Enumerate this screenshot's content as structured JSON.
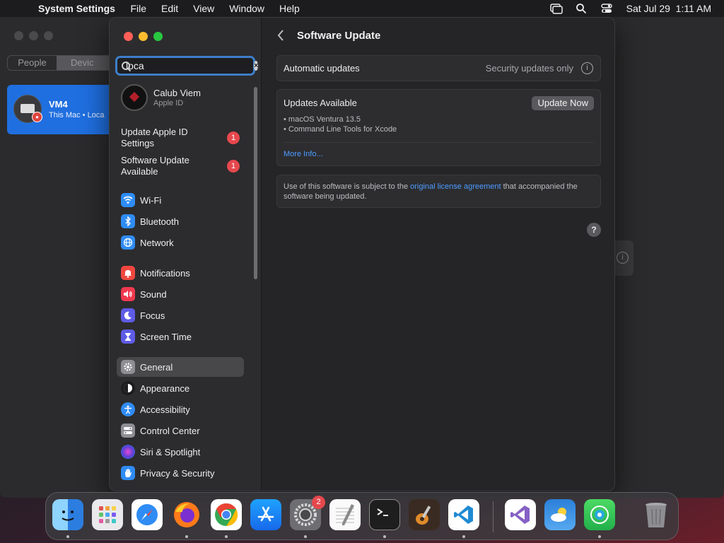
{
  "menubar": {
    "app_name": "System Settings",
    "menus": [
      "File",
      "Edit",
      "View",
      "Window",
      "Help"
    ],
    "datetime": "Sat Jul 29  1:11 AM"
  },
  "background_window": {
    "segments": [
      "People",
      "Devic"
    ],
    "device": {
      "name": "VM4",
      "subtitle": "This Mac • Loca"
    }
  },
  "sidebar": {
    "search": {
      "value": "loca",
      "placeholder": "Search"
    },
    "account": {
      "name": "Calub Viem",
      "subtitle": "Apple ID"
    },
    "alerts": [
      {
        "label": "Update Apple ID Settings",
        "badge": "1"
      },
      {
        "label": "Software Update Available",
        "badge": "1"
      }
    ],
    "items": [
      {
        "label": "Wi-Fi",
        "icon": "wifi-icon",
        "color": "#2f8cf4"
      },
      {
        "label": "Bluetooth",
        "icon": "bluetooth-icon",
        "color": "#2f8cf4"
      },
      {
        "label": "Network",
        "icon": "network-globe-icon",
        "color": "#2f8cf4"
      },
      {
        "label": "Notifications",
        "icon": "bell-icon",
        "color": "#f0473f"
      },
      {
        "label": "Sound",
        "icon": "speaker-icon",
        "color": "#f0394e"
      },
      {
        "label": "Focus",
        "icon": "moon-icon",
        "color": "#5e5ce6"
      },
      {
        "label": "Screen Time",
        "icon": "hourglass-icon",
        "color": "#5e5ce6"
      },
      {
        "label": "General",
        "icon": "gear-icon",
        "color": "#8e8e93"
      },
      {
        "label": "Appearance",
        "icon": "appearance-icon",
        "color": "#1c1c1e"
      },
      {
        "label": "Accessibility",
        "icon": "accessibility-icon",
        "color": "#2f8cf4"
      },
      {
        "label": "Control Center",
        "icon": "control-center-icon",
        "color": "#8e8e93"
      },
      {
        "label": "Siri & Spotlight",
        "icon": "siri-icon",
        "color": "#7a4fd8"
      },
      {
        "label": "Privacy & Security",
        "icon": "hand-icon",
        "color": "#2f8cf4"
      }
    ],
    "selected": "General"
  },
  "content": {
    "title": "Software Update",
    "automatic": {
      "label": "Automatic updates",
      "value": "Security updates only"
    },
    "updates": {
      "title": "Updates Available",
      "button": "Update Now",
      "items": [
        "• macOS Ventura 13.5",
        "• Command Line Tools for Xcode"
      ],
      "more_info": "More Info..."
    },
    "license": {
      "before": "Use of this software is subject to the ",
      "link": "original license agreement",
      "after": " that accompanied the software being updated."
    },
    "help": "?"
  },
  "dock": {
    "apps": [
      {
        "name": "Finder",
        "icon": "finder-icon"
      },
      {
        "name": "Launchpad",
        "icon": "launchpad-icon"
      },
      {
        "name": "Safari",
        "icon": "safari-icon"
      },
      {
        "name": "Firefox",
        "icon": "firefox-icon"
      },
      {
        "name": "Chrome",
        "icon": "chrome-icon"
      },
      {
        "name": "App Store",
        "icon": "app-store-icon"
      },
      {
        "name": "System Settings",
        "icon": "system-settings-icon",
        "badge": "2"
      },
      {
        "name": "TextEdit",
        "icon": "textedit-icon"
      },
      {
        "name": "Terminal",
        "icon": "terminal-icon"
      },
      {
        "name": "GarageBand",
        "icon": "garageband-icon"
      },
      {
        "name": "Visual Studio Code",
        "icon": "vscode-icon"
      },
      {
        "name": "Visual Studio",
        "icon": "visual-studio-icon"
      },
      {
        "name": "Weather",
        "icon": "weather-icon"
      },
      {
        "name": "Find My",
        "icon": "find-my-icon"
      },
      {
        "name": "Trash",
        "icon": "trash-icon"
      }
    ]
  }
}
